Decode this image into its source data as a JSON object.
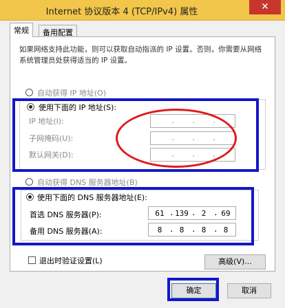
{
  "window": {
    "title": "Internet 协议版本 4 (TCP/IPv4) 属性",
    "close_glyph": "✕"
  },
  "tabs": [
    {
      "label": "常规",
      "active": true
    },
    {
      "label": "备用配置",
      "active": false
    }
  ],
  "description": "如果网络支持此功能，则可以获取自动指派的 IP 设置。否则，你需要从网络系统管理员处获得适当的 IP 设置。",
  "ip_section": {
    "auto_label": "自动获得 IP 地址(O)",
    "auto_selected": false,
    "manual_label": "使用下面的 IP 地址(S):",
    "manual_selected": true,
    "fields": [
      {
        "label": "IP 地址(I):",
        "value": [
          "",
          "",
          "",
          ""
        ]
      },
      {
        "label": "子网掩码(U):",
        "value": [
          "",
          "",
          "",
          ""
        ]
      },
      {
        "label": "默认网关(D):",
        "value": [
          "",
          "",
          "",
          ""
        ]
      }
    ]
  },
  "dns_section": {
    "auto_label": "自动获得 DNS 服务器地址(B)",
    "auto_selected": false,
    "manual_label": "使用下面的 DNS 服务器地址(E):",
    "manual_selected": true,
    "fields": [
      {
        "label": "首选 DNS 服务器(P):",
        "value": [
          "61",
          "139",
          "2",
          "69"
        ]
      },
      {
        "label": "备用 DNS 服务器(A):",
        "value": [
          "8",
          "8",
          "8",
          "8"
        ]
      }
    ]
  },
  "validate_on_exit": {
    "label": "退出时验证设置(L)",
    "checked": false
  },
  "buttons": {
    "advanced": "高级(V)...",
    "ok": "确定",
    "cancel": "取消"
  },
  "colors": {
    "titlebar": "#f2c64a",
    "close_button": "#c7352d",
    "annotation_rect": "#1616c8",
    "annotation_ellipse": "#e01919"
  }
}
